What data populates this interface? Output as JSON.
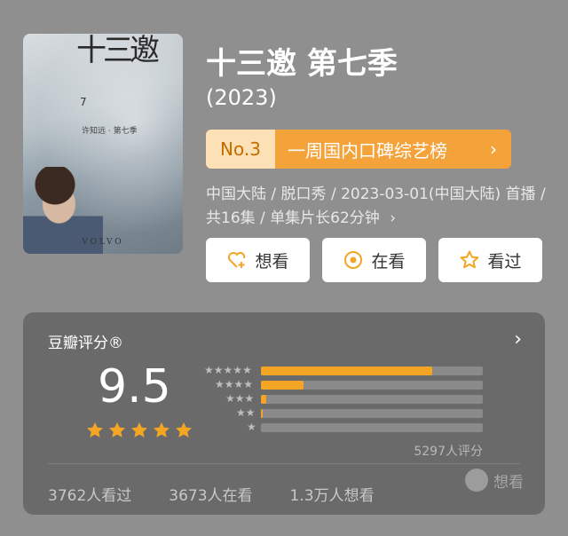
{
  "poster": {
    "title_art": "十三邀",
    "season_art": "7",
    "subtitle_art": "许知远 · 第七季",
    "brand": "VOLVO"
  },
  "show": {
    "title": "十三邀  第七季",
    "year": "(2023)"
  },
  "ranking": {
    "rank": "No.3",
    "list_name": "一周国内口碑综艺榜",
    "chevron": "›"
  },
  "meta": {
    "text": "中国大陆 / 脱口秀 / 2023-03-01(中国大陆) 首播 / 共16集 / 单集片长62分钟",
    "chevron": "›"
  },
  "actions": {
    "want": {
      "label": "想看",
      "icon": "heart-plus-icon"
    },
    "watching": {
      "label": "在看",
      "icon": "target-icon"
    },
    "watched": {
      "label": "看过",
      "icon": "star-outline-icon"
    }
  },
  "rating": {
    "label": "豆瓣评分®",
    "score": "9.5",
    "stars": 5,
    "distribution": [
      {
        "stars": 5,
        "fraction": 0.77
      },
      {
        "stars": 4,
        "fraction": 0.19
      },
      {
        "stars": 3,
        "fraction": 0.025
      },
      {
        "stars": 2,
        "fraction": 0.006
      },
      {
        "stars": 1,
        "fraction": 0.0
      }
    ],
    "count": "5297人评分",
    "chevron": "›"
  },
  "stats": {
    "watched": "3762人看过",
    "watching": "3673人在看",
    "want": "1.3万人想看",
    "want_tag": "想看"
  },
  "colors": {
    "accent": "#f5a524",
    "background": "#8f8f8f",
    "card": "#6a6a6a"
  }
}
